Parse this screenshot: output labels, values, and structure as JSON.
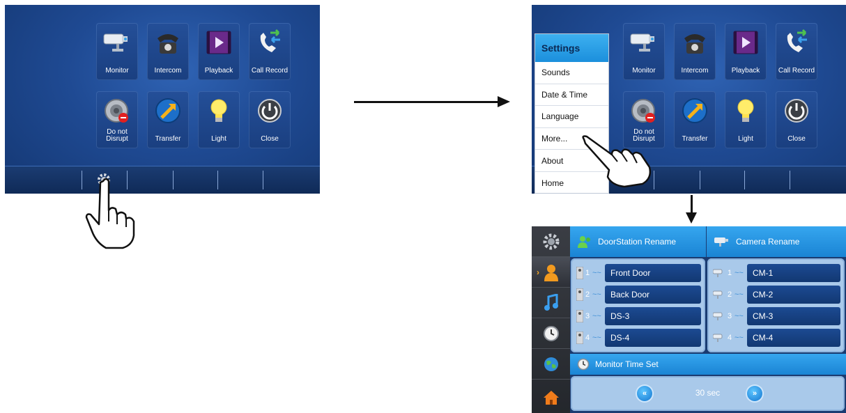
{
  "home_screen": {
    "tiles": [
      {
        "label": "Monitor",
        "icon": "cctv-camera-icon"
      },
      {
        "label": "Intercom",
        "icon": "telephone-icon"
      },
      {
        "label": "Playback",
        "icon": "play-icon"
      },
      {
        "label": "Call Record",
        "icon": "phone-arrows-icon"
      },
      {
        "label": "Do not\nDisrupt",
        "icon": "speaker-mute-icon"
      },
      {
        "label": "Transfer",
        "icon": "transfer-arrow-icon"
      },
      {
        "label": "Light",
        "icon": "light-bulb-icon"
      },
      {
        "label": "Close",
        "icon": "power-icon"
      }
    ]
  },
  "settings_menu": {
    "title": "Settings",
    "items": [
      "Sounds",
      "Date & Time",
      "Language",
      "More...",
      "About",
      "Home"
    ]
  },
  "more_screen": {
    "door_header": "DoorStation Rename",
    "camera_header": "Camera Rename",
    "door_stations": [
      {
        "index": "1",
        "name": "Front Door"
      },
      {
        "index": "2",
        "name": "Back Door"
      },
      {
        "index": "3",
        "name": "DS-3"
      },
      {
        "index": "4",
        "name": "DS-4"
      }
    ],
    "cameras": [
      {
        "index": "1",
        "name": "CM-1"
      },
      {
        "index": "2",
        "name": "CM-2"
      },
      {
        "index": "3",
        "name": "CM-3"
      },
      {
        "index": "4",
        "name": "CM-4"
      }
    ],
    "monitor_time_label": "Monitor Time Set",
    "monitor_time_value": "30 sec",
    "decrease_symbol": "«",
    "increase_symbol": "»"
  },
  "colors": {
    "screen_blue": "#1f4a93",
    "header_blue": "#1a84d4",
    "box_light_blue": "#a9c9ea",
    "sidebar_dark": "#2d3037"
  }
}
